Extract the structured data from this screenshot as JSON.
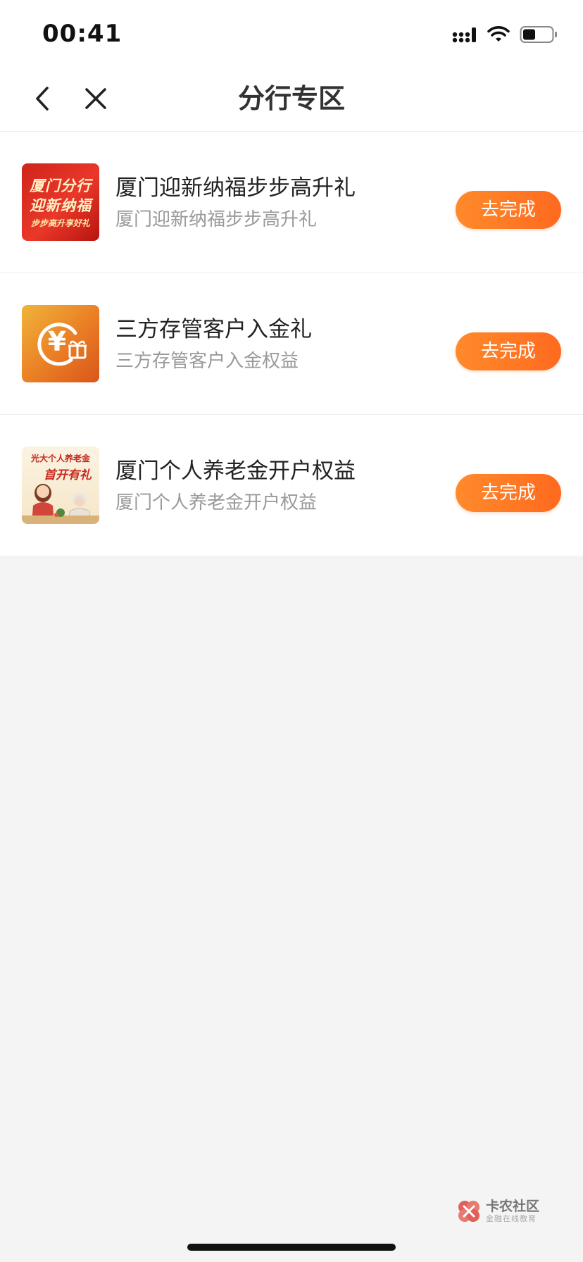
{
  "status_bar": {
    "time": "00:41"
  },
  "nav": {
    "title": "分行专区"
  },
  "items": [
    {
      "title": "厦门迎新纳福步步高升礼",
      "subtitle": "厦门迎新纳福步步高升礼",
      "button": "去完成",
      "thumb_lines": [
        "厦门分行",
        "迎新纳福",
        "步步高升享好礼"
      ]
    },
    {
      "title": "三方存管客户入金礼",
      "subtitle": "三方存管客户入金权益",
      "button": "去完成",
      "thumb_symbol": "¥"
    },
    {
      "title": "厦门个人养老金开户权益",
      "subtitle": "厦门个人养老金开户权益",
      "button": "去完成",
      "thumb_lines": [
        "光大个人养老金",
        "首开有礼"
      ]
    }
  ],
  "watermark": {
    "title": "卡农社区",
    "subtitle": "金融在线教育"
  },
  "colors": {
    "accent": "#ff7a25",
    "background": "#f4f4f4"
  }
}
